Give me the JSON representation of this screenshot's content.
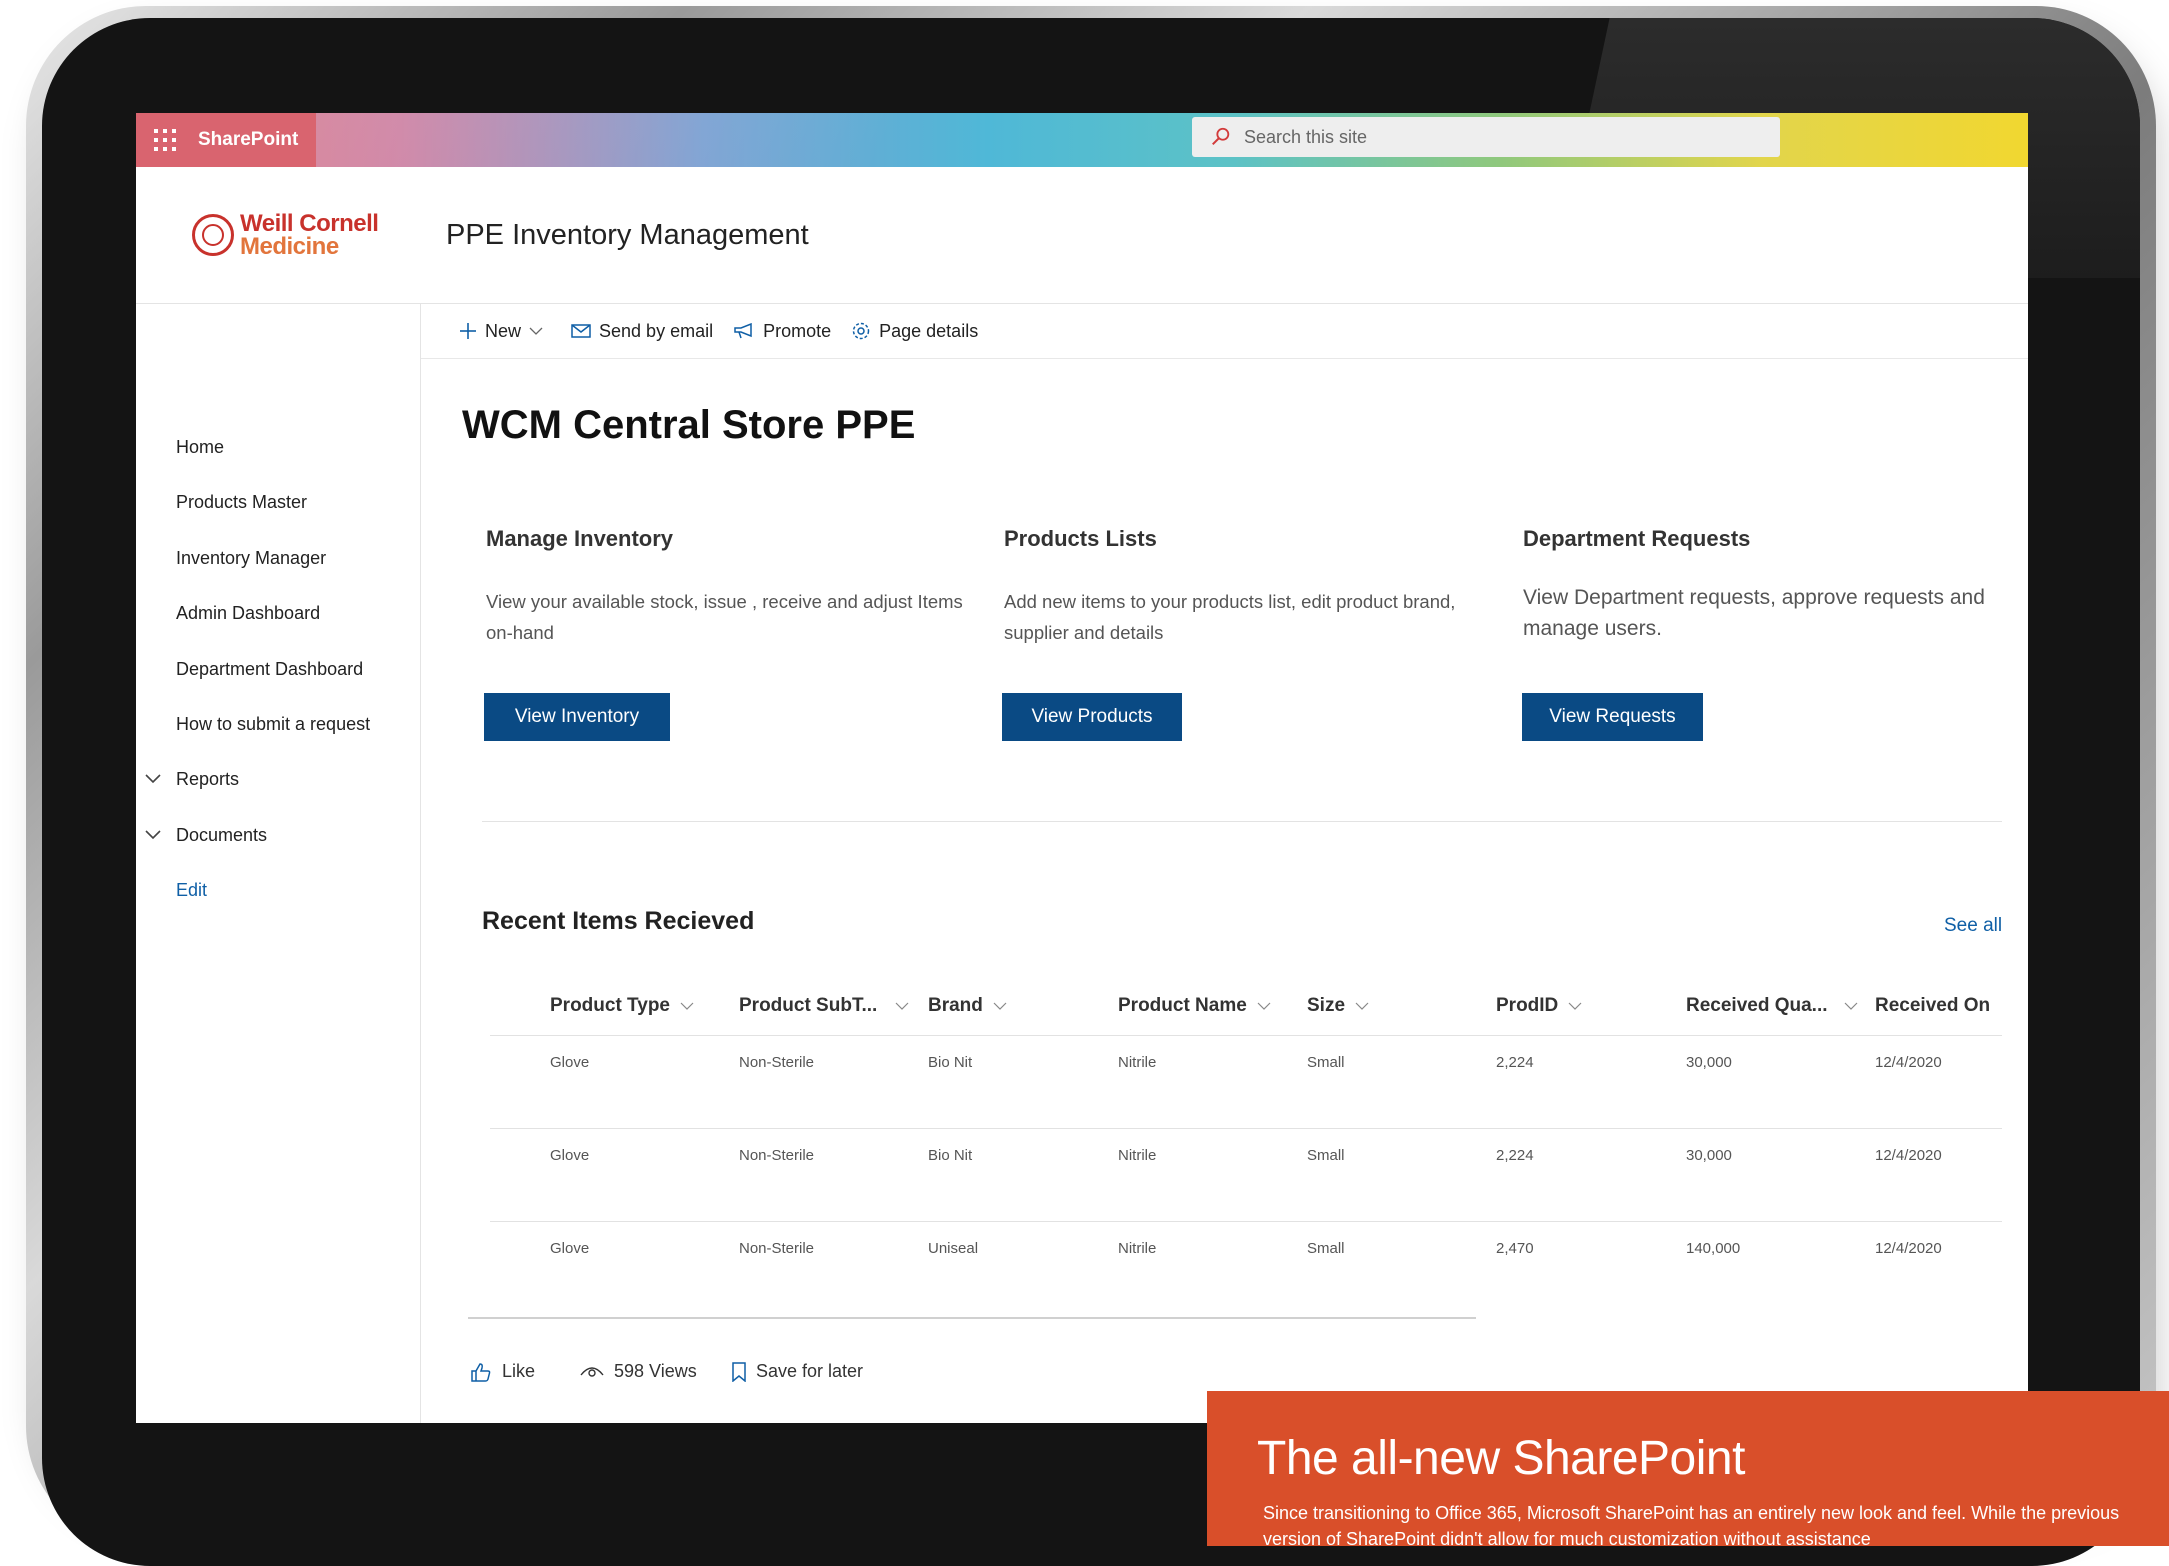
{
  "suitebar": {
    "app_name": "SharePoint",
    "search_placeholder": "Search this site"
  },
  "site": {
    "logo_line1": "Weill Cornell",
    "logo_line2": "Medicine",
    "title": "PPE Inventory Management"
  },
  "nav": {
    "items": [
      {
        "label": "Home"
      },
      {
        "label": "Products Master"
      },
      {
        "label": "Inventory Manager"
      },
      {
        "label": "Admin Dashboard"
      },
      {
        "label": "Department Dashboard"
      },
      {
        "label": "How to submit a request"
      },
      {
        "label": "Reports"
      },
      {
        "label": "Documents"
      }
    ],
    "edit_label": "Edit"
  },
  "commandbar": {
    "new_label": "New",
    "send_label": "Send by email",
    "promote_label": "Promote",
    "details_label": "Page details"
  },
  "page": {
    "title": "WCM Central Store PPE"
  },
  "cards": [
    {
      "title": "Manage Inventory",
      "text": "View your available stock, issue , receive and adjust Items on-hand",
      "button": "View Inventory"
    },
    {
      "title": "Products Lists",
      "text": "Add new items to your products list, edit product brand, supplier and details",
      "button": "View Products"
    },
    {
      "title": "Department Requests",
      "text": "View Department requests, approve requests and manage users.",
      "button": "View Requests"
    }
  ],
  "recent": {
    "title": "Recent Items Recieved",
    "see_all": "See all",
    "columns": [
      "Product Type",
      "Product SubT...",
      "Brand",
      "Product Name",
      "Size",
      "ProdID",
      "Received Qua...",
      "Received On"
    ],
    "rows": [
      [
        "Glove",
        "Non-Sterile",
        "Bio Nit",
        "Nitrile",
        "Small",
        "2,224",
        "30,000",
        "12/4/2020"
      ],
      [
        "Glove",
        "Non-Sterile",
        "Bio Nit",
        "Nitrile",
        "Small",
        "2,224",
        "30,000",
        "12/4/2020"
      ],
      [
        "Glove",
        "Non-Sterile",
        "Uniseal",
        "Nitrile",
        "Small",
        "2,470",
        "140,000",
        "12/4/2020"
      ]
    ]
  },
  "footer": {
    "like_label": "Like",
    "views_label": "598 Views",
    "save_label": "Save for later"
  },
  "promo": {
    "title": "The all-new SharePoint",
    "text": "Since transitioning to Office 365, Microsoft SharePoint has an entirely new look and feel. While the previous version of SharePoint didn't allow for much customization without assistance"
  },
  "colors": {
    "accent": "#0a4a84",
    "link": "#0f5fa6",
    "promo": "#d94f2a",
    "brand_red": "#c8322c",
    "brand_orange": "#e2753c"
  }
}
